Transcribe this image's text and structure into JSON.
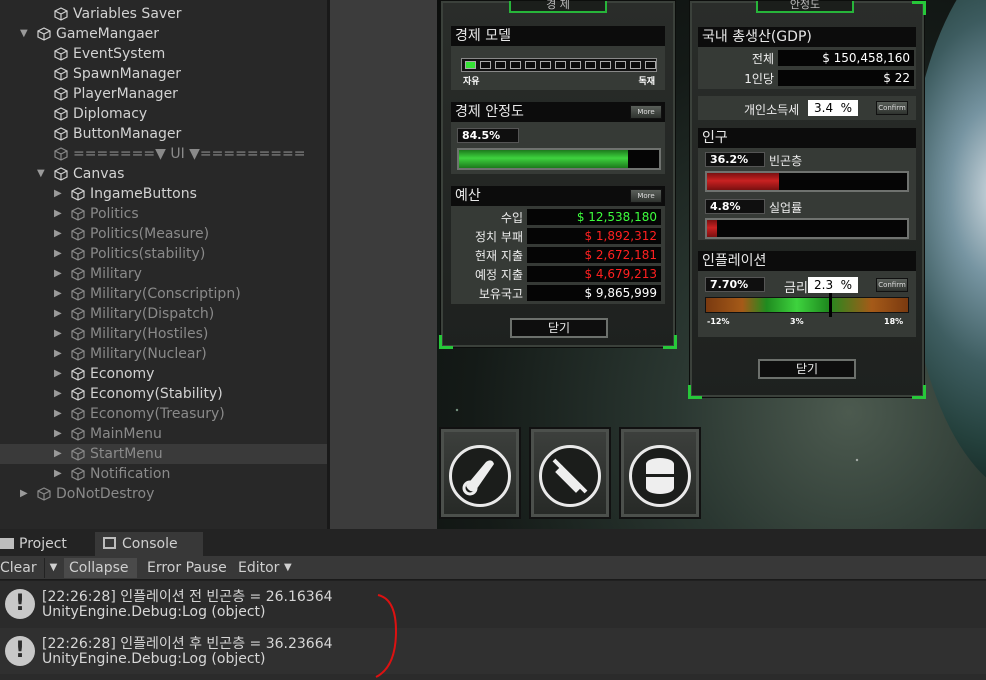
{
  "hierarchy": {
    "rows": [
      {
        "label": "Variables Saver",
        "indent": 3,
        "arrow": "",
        "dim": false
      },
      {
        "label": "GameMangaer",
        "indent": 2,
        "arrow": "down",
        "dim": false
      },
      {
        "label": "EventSystem",
        "indent": 3,
        "arrow": "",
        "dim": false
      },
      {
        "label": "SpawnManager",
        "indent": 3,
        "arrow": "",
        "dim": false
      },
      {
        "label": "PlayerManager",
        "indent": 3,
        "arrow": "",
        "dim": false
      },
      {
        "label": "Diplomacy",
        "indent": 3,
        "arrow": "",
        "dim": false
      },
      {
        "label": "ButtonManager",
        "indent": 3,
        "arrow": "",
        "dim": false
      },
      {
        "label": "=======▼ UI ▼=========",
        "indent": 3,
        "arrow": "",
        "dim": true
      },
      {
        "label": "Canvas",
        "indent": 3,
        "arrow": "down",
        "dim": false
      },
      {
        "label": "IngameButtons",
        "indent": 4,
        "arrow": "right",
        "dim": false
      },
      {
        "label": "Politics",
        "indent": 4,
        "arrow": "right",
        "dim": true
      },
      {
        "label": "Politics(Measure)",
        "indent": 4,
        "arrow": "right",
        "dim": true
      },
      {
        "label": "Politics(stability)",
        "indent": 4,
        "arrow": "right",
        "dim": true
      },
      {
        "label": "Military",
        "indent": 4,
        "arrow": "right",
        "dim": true
      },
      {
        "label": "Military(Conscriptipn)",
        "indent": 4,
        "arrow": "right",
        "dim": true
      },
      {
        "label": "Military(Dispatch)",
        "indent": 4,
        "arrow": "right",
        "dim": true
      },
      {
        "label": "Military(Hostiles)",
        "indent": 4,
        "arrow": "right",
        "dim": true
      },
      {
        "label": "Military(Nuclear)",
        "indent": 4,
        "arrow": "right",
        "dim": true
      },
      {
        "label": "Economy",
        "indent": 4,
        "arrow": "right",
        "dim": false
      },
      {
        "label": "Economy(Stability)",
        "indent": 4,
        "arrow": "right",
        "dim": false
      },
      {
        "label": "Economy(Treasury)",
        "indent": 4,
        "arrow": "right",
        "dim": true
      },
      {
        "label": "MainMenu",
        "indent": 4,
        "arrow": "right",
        "dim": true
      },
      {
        "label": "StartMenu",
        "indent": 4,
        "arrow": "right",
        "dim": true,
        "selected": true
      },
      {
        "label": "Notification",
        "indent": 4,
        "arrow": "right",
        "dim": true
      },
      {
        "label": "DoNotDestroy",
        "indent": 2,
        "arrow": "right",
        "dim": true
      }
    ]
  },
  "game": {
    "left_panel": {
      "tab_title": "경 제",
      "model": {
        "title": "경제 모델",
        "left": "자유",
        "right": "독재",
        "level": 0.05
      },
      "stability": {
        "title": "경제 안정도",
        "more": "More",
        "value_text": "84.5%",
        "value": 0.845
      },
      "budget": {
        "title": "예산",
        "more": "More",
        "rows": [
          {
            "label": "수입",
            "value": "$ 12,538,180",
            "color": "#3dff3d"
          },
          {
            "label": "정치 부패",
            "value": "$ 1,892,312",
            "color": "#ff2020"
          },
          {
            "label": "현재 지출",
            "value": "$ 2,672,181",
            "color": "#ff2020"
          },
          {
            "label": "예정 지출",
            "value": "$ 4,679,213",
            "color": "#ff2020"
          },
          {
            "label": "보유국고",
            "value": "$ 9,865,999",
            "color": "#ffffff"
          }
        ]
      },
      "close": "닫기"
    },
    "right_panel": {
      "tab_title": "안정도",
      "gdp": {
        "title": "국내 총생산(GDP)",
        "total_label": "전체",
        "total_value": "$ 150,458,160",
        "per_label": "1인당",
        "per_value": "$ 22"
      },
      "tax": {
        "label": "개인소득세",
        "value": "3.4",
        "unit": "%",
        "confirm": "Confirm"
      },
      "population": {
        "title": "인구",
        "poverty_text": "36.2%",
        "poverty_label": "빈곤층",
        "poverty": 0.362,
        "unemp_text": "4.8%",
        "unemp_label": "실업률",
        "unemp": 0.048
      },
      "inflation": {
        "title": "인플레이션",
        "value_text": "7.70%",
        "rate_label": "금리",
        "rate_value": "2.3",
        "rate_unit": "%",
        "confirm": "Confirm",
        "scale_left": "-12%",
        "scale_mid": "3%",
        "scale_right": "18%"
      },
      "close": "닫기"
    },
    "icons": [
      "scroll-icon",
      "syringe-icon",
      "barrel-icon"
    ]
  },
  "console": {
    "tabs": [
      "Project",
      "Console"
    ],
    "toolbar": {
      "clear": "Clear",
      "collapse": "Collapse",
      "error_pause": "Error Pause",
      "editor": "Editor"
    },
    "logs": [
      {
        "line1": "[22:26:28] 인플레이션 전 빈곤층 =  26.16364",
        "line2": "UnityEngine.Debug:Log (object)"
      },
      {
        "line1": "[22:26:28] 인플레이션 후 빈곤층 =  36.23664",
        "line2": "UnityEngine.Debug:Log (object)"
      }
    ]
  }
}
